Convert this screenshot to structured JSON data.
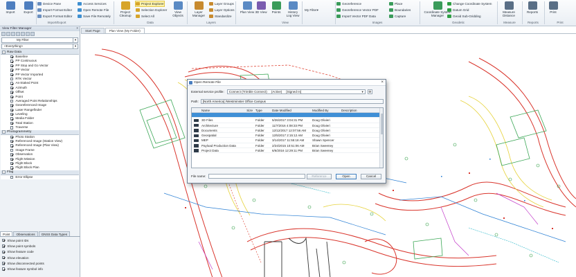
{
  "ribbon": {
    "big_buttons": [
      {
        "label": "Import",
        "icon": "import-icon",
        "color": "#4f7fbf"
      },
      {
        "label": "Export",
        "icon": "export-icon",
        "color": "#4f7fbf"
      },
      {
        "label": "Project Cleanup",
        "icon": "cleanup-icon",
        "color": "#d7a52b"
      },
      {
        "label": "View Objects",
        "icon": "view-objects-icon",
        "color": "#5a8ac4"
      },
      {
        "label": "Layer Manager",
        "icon": "layer-manager-icon",
        "color": "#c78a2e"
      },
      {
        "label": "Plan View",
        "icon": "plan-view-icon",
        "color": "#5a8ac4"
      },
      {
        "label": "3D View",
        "icon": "3d-view-icon",
        "color": "#7a5cb0"
      },
      {
        "label": "Points",
        "icon": "points-icon",
        "color": "#3a9b5a"
      },
      {
        "label": "History Log View",
        "icon": "history-icon",
        "color": "#5a8ac4"
      },
      {
        "label": "Coordinate System Manager",
        "icon": "coordinate-system-icon",
        "color": "#3a9b5a"
      },
      {
        "label": "Measure Distance",
        "icon": "measure-icon",
        "color": "#5a6f86"
      },
      {
        "label": "Reports",
        "icon": "reports-icon",
        "color": "#5a6f86"
      },
      {
        "label": "Print",
        "icon": "print-icon",
        "color": "#5a6f86"
      }
    ],
    "small": {
      "import_export": [
        "Device Pane",
        "Import Format Editor",
        "Export Format Editor"
      ],
      "access": [
        "Access Services",
        "Open Remote File",
        "Save File Remotely"
      ],
      "data": [
        "Project Explorer",
        "Selection Explorer",
        "Select All"
      ],
      "layers": [
        "Layer Groups",
        "Layer Options",
        "Standardize"
      ],
      "filter": "My Filter",
      "images": [
        "Georeference",
        "Georeference Vector PDF",
        "Import Vector PDF Data"
      ],
      "images2": [
        "Place",
        "Boundaries",
        "Capture"
      ],
      "geodetic": [
        "Change Coordinate System",
        "Datum Grid",
        "Geoid Sub-Gridding"
      ]
    },
    "groups": [
      "Import/Export",
      "Data",
      "Layers",
      "View",
      "Images",
      "Geodetic",
      "Measure",
      "Reports",
      "Print"
    ]
  },
  "left_panel": {
    "title": "View Filter Manager",
    "filter": "My Filter",
    "scope": "<Everything>",
    "sections": [
      {
        "title": "Raw Data",
        "items": [
          {
            "label": "Baseline",
            "checked": true
          },
          {
            "label": "PP Continuous",
            "checked": true
          },
          {
            "label": "PP Stop and Go Vector",
            "checked": true
          },
          {
            "label": "PP Vector",
            "checked": true
          },
          {
            "label": "PP Vector Imported",
            "checked": true
          },
          {
            "label": "RTK Vector",
            "checked": false
          },
          {
            "label": "As-Staked Point",
            "checked": true
          },
          {
            "label": "Azimuth",
            "checked": true
          },
          {
            "label": "Offset",
            "checked": true
          },
          {
            "label": "Point",
            "checked": true
          },
          {
            "label": "Averaged Point Relationships",
            "checked": false
          },
          {
            "label": "Georeferenced Image",
            "checked": true
          },
          {
            "label": "Laser Rangefinder",
            "checked": true
          },
          {
            "label": "Leveling",
            "checked": true
          },
          {
            "label": "Media Folder",
            "checked": true
          },
          {
            "label": "Total Station",
            "checked": true
          },
          {
            "label": "Traverse",
            "checked": false
          }
        ]
      },
      {
        "title": "Photogrammetry",
        "items": [
          {
            "label": "Photo Station",
            "checked": true
          },
          {
            "label": "Referenced Image (Station View)",
            "checked": true
          },
          {
            "label": "Referenced Image (Plan View)",
            "checked": true
          },
          {
            "label": "Image Frame",
            "checked": false
          },
          {
            "label": "Observation",
            "checked": true
          },
          {
            "label": "Flight Mission",
            "checked": true
          },
          {
            "label": "Flight Block",
            "checked": true
          },
          {
            "label": "Flight Block Plan",
            "checked": true
          }
        ]
      },
      {
        "title": "Flag",
        "items": [
          {
            "label": "Error Ellipse",
            "checked": false
          }
        ]
      }
    ],
    "tabs": [
      "Point",
      "Observations",
      "GNSS Data Types"
    ],
    "options": [
      {
        "label": "Show point IDs",
        "checked": true
      },
      {
        "label": "Show point symbols",
        "checked": true
      },
      {
        "label": "Show feature code",
        "checked": true
      },
      {
        "label": "Show elevation",
        "checked": true
      },
      {
        "label": "Show disconnected points",
        "checked": true
      },
      {
        "label": "Show feature symbol info",
        "checked": true
      }
    ]
  },
  "doc_tabs": [
    "Start Page",
    "Plan View (My Folder)"
  ],
  "dialog": {
    "title": "Open Remote File",
    "service_label": "External service profile:",
    "service_value": "Connect (Trimble Connect)",
    "service_status": "(Active)",
    "service_signed": "[Signed In]",
    "path_label": "Path:",
    "path_value": "[North America] /Westminster Office Campus",
    "columns": [
      "Name",
      "Size",
      "Type",
      "Date Modified",
      "Modified By",
      "Description"
    ],
    "rows": [
      {
        "name": "",
        "size": "",
        "type": "",
        "date": "",
        "by": "",
        "selected": true
      },
      {
        "name": "3D Files",
        "size": "",
        "type": "Folder",
        "date": "5/26/2017 3:04:31 PM",
        "by": "Doug Olivieri",
        "selected": false
      },
      {
        "name": "Architecture",
        "size": "",
        "type": "Folder",
        "date": "11/7/2016 4:08:33 PM",
        "by": "Doug Olivieri",
        "selected": false
      },
      {
        "name": "Documents",
        "size": "",
        "type": "Folder",
        "date": "12/12/2017 12:07:56 AM",
        "by": "Doug Olivieri",
        "selected": false
      },
      {
        "name": "Geospatial",
        "size": "",
        "type": "Folder",
        "date": "12/5/2017 2:15:12 AM",
        "by": "Doug Olivieri",
        "selected": false
      },
      {
        "name": "MEP",
        "size": "",
        "type": "Folder",
        "date": "3/14/2017 11:55:18 AM",
        "by": "Shawn Spencer",
        "selected": false
      },
      {
        "name": "Payload Production Data",
        "size": "",
        "type": "Folder",
        "date": "2/24/2015 10:51:06 AM",
        "by": "Brian Sweeney",
        "selected": false
      },
      {
        "name": "Project Data",
        "size": "",
        "type": "Folder",
        "date": "6/6/2016 12:29:11 PM",
        "by": "Brian Sweeney",
        "selected": false
      }
    ],
    "file_name_label": "File name:",
    "file_name_value": "",
    "buttons": {
      "reference": "Reference",
      "open": "Open",
      "cancel": "Cancel"
    }
  }
}
